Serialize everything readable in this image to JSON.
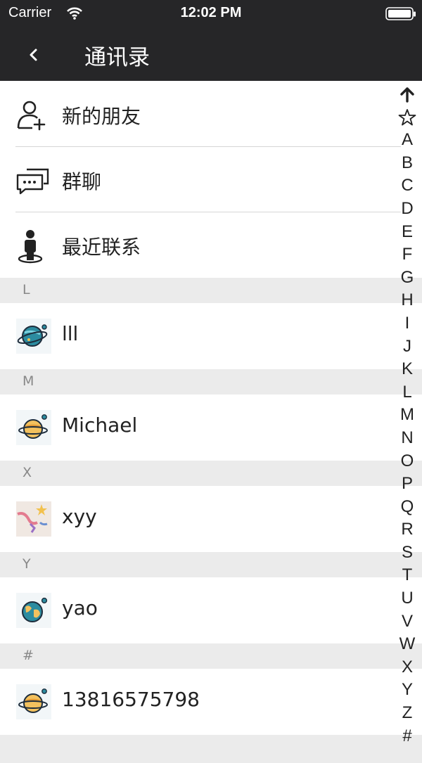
{
  "status_bar": {
    "carrier": "Carrier",
    "time": "12:02 PM"
  },
  "nav": {
    "title": "通讯录"
  },
  "menu": [
    {
      "label": "新的朋友",
      "icon": "add-friend-icon"
    },
    {
      "label": "群聊",
      "icon": "group-chat-icon"
    },
    {
      "label": "最近联系",
      "icon": "recent-contact-icon"
    }
  ],
  "sections": [
    {
      "letter": "L",
      "contacts": [
        {
          "name": "lll",
          "avatar": "planet-blue-icon"
        }
      ]
    },
    {
      "letter": "M",
      "contacts": [
        {
          "name": "Michael",
          "avatar": "planet-saturn-icon"
        }
      ]
    },
    {
      "letter": "X",
      "contacts": [
        {
          "name": "xyy",
          "avatar": "photo-avatar"
        }
      ]
    },
    {
      "letter": "Y",
      "contacts": [
        {
          "name": "yao",
          "avatar": "earth-icon"
        }
      ]
    },
    {
      "letter": "#",
      "contacts": [
        {
          "name": "13816575798",
          "avatar": "planet-saturn-icon"
        }
      ]
    }
  ],
  "index": [
    "A",
    "B",
    "C",
    "D",
    "E",
    "F",
    "G",
    "H",
    "I",
    "J",
    "K",
    "L",
    "M",
    "N",
    "O",
    "P",
    "Q",
    "R",
    "S",
    "T",
    "U",
    "V",
    "W",
    "X",
    "Y",
    "Z",
    "#"
  ],
  "colors": {
    "nav_background": "#262628",
    "section_background": "#ebebeb",
    "text": "#222222",
    "section_text": "#888888"
  }
}
